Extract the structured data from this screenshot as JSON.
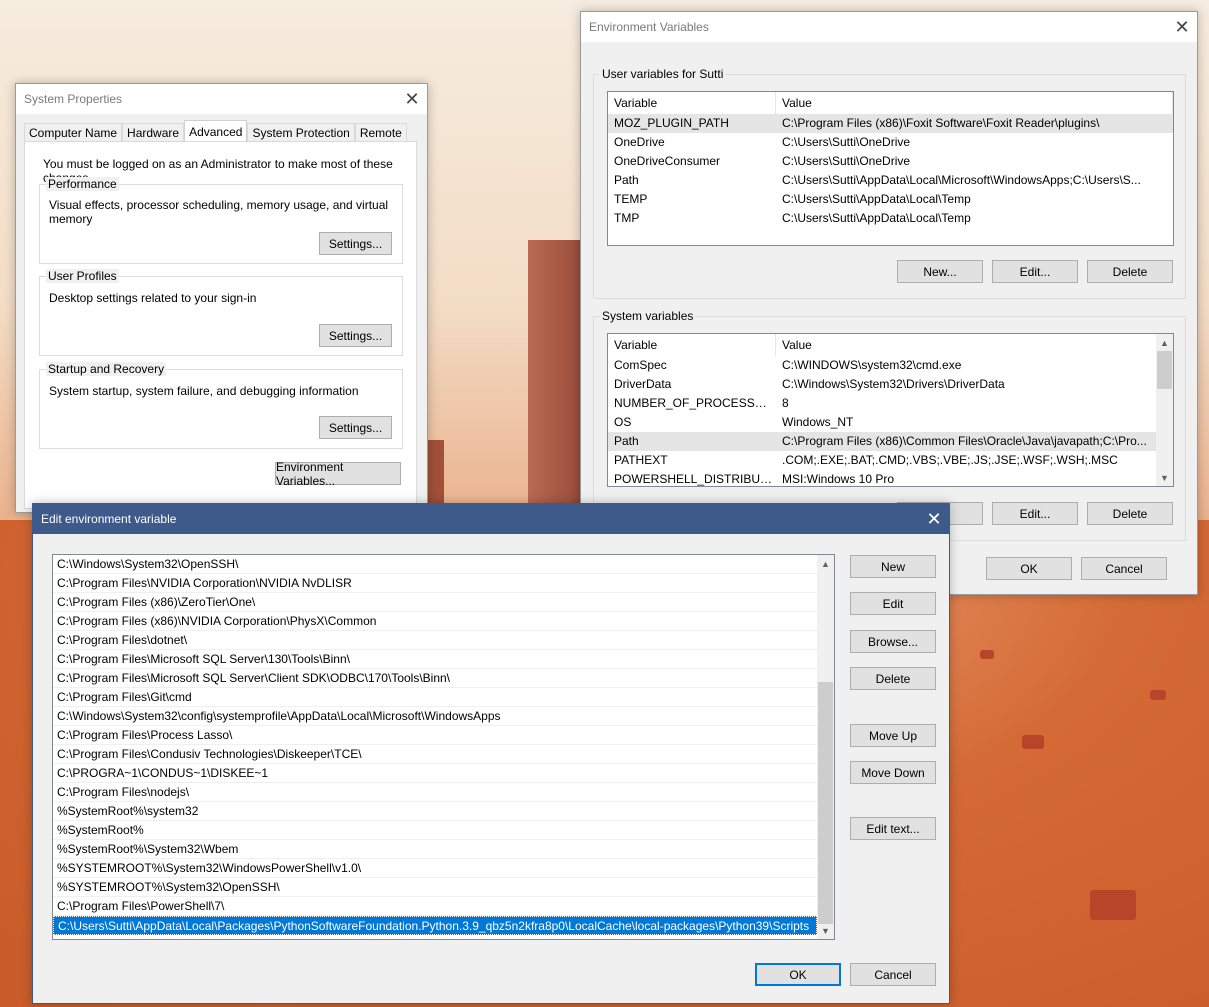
{
  "sysprops": {
    "title": "System Properties",
    "tabs": [
      "Computer Name",
      "Hardware",
      "Advanced",
      "System Protection",
      "Remote"
    ],
    "admin_note": "You must be logged on as an Administrator to make most of these changes.",
    "performance": {
      "label": "Performance",
      "desc": "Visual effects, processor scheduling, memory usage, and virtual memory",
      "button": "Settings..."
    },
    "profiles": {
      "label": "User Profiles",
      "desc": "Desktop settings related to your sign-in",
      "button": "Settings..."
    },
    "startup": {
      "label": "Startup and Recovery",
      "desc": "System startup, system failure, and debugging information",
      "button": "Settings..."
    },
    "env_button": "Environment Variables..."
  },
  "envvars": {
    "title": "Environment Variables",
    "user_group": "User variables for Sutti",
    "sys_group": "System variables",
    "col_variable": "Variable",
    "col_value": "Value",
    "user_rows": [
      {
        "var": "MOZ_PLUGIN_PATH",
        "val": "C:\\Program Files (x86)\\Foxit Software\\Foxit Reader\\plugins\\"
      },
      {
        "var": "OneDrive",
        "val": "C:\\Users\\Sutti\\OneDrive"
      },
      {
        "var": "OneDriveConsumer",
        "val": "C:\\Users\\Sutti\\OneDrive"
      },
      {
        "var": "Path",
        "val": "C:\\Users\\Sutti\\AppData\\Local\\Microsoft\\WindowsApps;C:\\Users\\S..."
      },
      {
        "var": "TEMP",
        "val": "C:\\Users\\Sutti\\AppData\\Local\\Temp"
      },
      {
        "var": "TMP",
        "val": "C:\\Users\\Sutti\\AppData\\Local\\Temp"
      }
    ],
    "sys_rows": [
      {
        "var": "ComSpec",
        "val": "C:\\WINDOWS\\system32\\cmd.exe"
      },
      {
        "var": "DriverData",
        "val": "C:\\Windows\\System32\\Drivers\\DriverData"
      },
      {
        "var": "NUMBER_OF_PROCESSORS",
        "val": "8"
      },
      {
        "var": "OS",
        "val": "Windows_NT"
      },
      {
        "var": "Path",
        "val": "C:\\Program Files (x86)\\Common Files\\Oracle\\Java\\javapath;C:\\Pro..."
      },
      {
        "var": "PATHEXT",
        "val": ".COM;.EXE;.BAT;.CMD;.VBS;.VBE;.JS;.JSE;.WSF;.WSH;.MSC"
      },
      {
        "var": "POWERSHELL_DISTRIBUTIO...",
        "val": "MSI:Windows 10 Pro"
      }
    ],
    "new_button": "New...",
    "edit_button": "Edit...",
    "delete_button": "Delete",
    "sys_new_partial": "...",
    "ok": "OK",
    "cancel": "Cancel"
  },
  "editvar": {
    "title": "Edit environment variable",
    "paths": [
      "C:\\Windows\\System32\\OpenSSH\\",
      "C:\\Program Files\\NVIDIA Corporation\\NVIDIA NvDLISR",
      "C:\\Program Files (x86)\\ZeroTier\\One\\",
      "C:\\Program Files (x86)\\NVIDIA Corporation\\PhysX\\Common",
      "C:\\Program Files\\dotnet\\",
      "C:\\Program Files\\Microsoft SQL Server\\130\\Tools\\Binn\\",
      "C:\\Program Files\\Microsoft SQL Server\\Client SDK\\ODBC\\170\\Tools\\Binn\\",
      "C:\\Program Files\\Git\\cmd",
      "C:\\Windows\\System32\\config\\systemprofile\\AppData\\Local\\Microsoft\\WindowsApps",
      "C:\\Program Files\\Process Lasso\\",
      "C:\\Program Files\\Condusiv Technologies\\Diskeeper\\TCE\\",
      "C:\\PROGRA~1\\CONDUS~1\\DISKEE~1",
      "C:\\Program Files\\nodejs\\",
      "%SystemRoot%\\system32",
      "%SystemRoot%",
      "%SystemRoot%\\System32\\Wbem",
      "%SYSTEMROOT%\\System32\\WindowsPowerShell\\v1.0\\",
      "%SYSTEMROOT%\\System32\\OpenSSH\\",
      "C:\\Program Files\\PowerShell\\7\\",
      "C:\\Users\\Sutti\\AppData\\Local\\Packages\\PythonSoftwareFoundation.Python.3.9_qbz5n2kfra8p0\\LocalCache\\local-packages\\Python39\\Scripts"
    ],
    "selected_index": 19,
    "buttons": {
      "new": "New",
      "edit": "Edit",
      "browse": "Browse...",
      "delete": "Delete",
      "move_up": "Move Up",
      "move_down": "Move Down",
      "edit_text": "Edit text..."
    },
    "ok": "OK",
    "cancel": "Cancel"
  },
  "colors": {
    "accent": "#0078d7",
    "edit_titlebar": "#3d5a8a"
  }
}
